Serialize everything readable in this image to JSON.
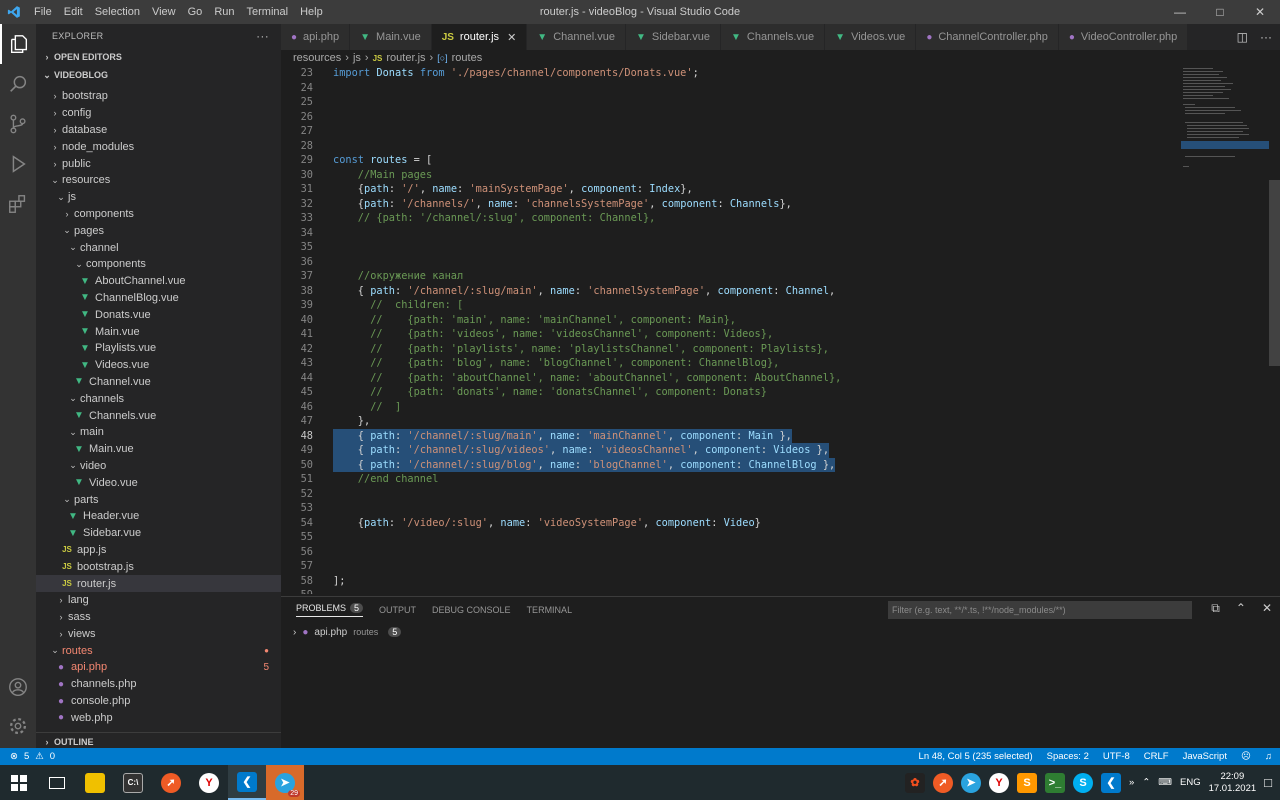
{
  "window": {
    "title": "router.js - videoBlog - Visual Studio Code",
    "menu": [
      "File",
      "Edit",
      "Selection",
      "View",
      "Go",
      "Run",
      "Terminal",
      "Help"
    ]
  },
  "explorer": {
    "header": "EXPLORER",
    "open_editors": "OPEN EDITORS",
    "project": "VIDEOBLOG",
    "outline": "OUTLINE",
    "tree": [
      {
        "label": "bootstrap",
        "depth": 0,
        "type": "folder",
        "open": false
      },
      {
        "label": "config",
        "depth": 0,
        "type": "folder",
        "open": false
      },
      {
        "label": "database",
        "depth": 0,
        "type": "folder",
        "open": false
      },
      {
        "label": "node_modules",
        "depth": 0,
        "type": "folder",
        "open": false
      },
      {
        "label": "public",
        "depth": 0,
        "type": "folder",
        "open": false
      },
      {
        "label": "resources",
        "depth": 0,
        "type": "folder",
        "open": true
      },
      {
        "label": "js",
        "depth": 1,
        "type": "folder",
        "open": true
      },
      {
        "label": "components",
        "depth": 2,
        "type": "folder",
        "open": false
      },
      {
        "label": "pages",
        "depth": 2,
        "type": "folder",
        "open": true
      },
      {
        "label": "channel",
        "depth": 3,
        "type": "folder",
        "open": true
      },
      {
        "label": "components",
        "depth": 4,
        "type": "folder",
        "open": true
      },
      {
        "label": "AboutChannel.vue",
        "depth": 5,
        "type": "vue"
      },
      {
        "label": "ChannelBlog.vue",
        "depth": 5,
        "type": "vue"
      },
      {
        "label": "Donats.vue",
        "depth": 5,
        "type": "vue"
      },
      {
        "label": "Main.vue",
        "depth": 5,
        "type": "vue"
      },
      {
        "label": "Playlists.vue",
        "depth": 5,
        "type": "vue"
      },
      {
        "label": "Videos.vue",
        "depth": 5,
        "type": "vue"
      },
      {
        "label": "Channel.vue",
        "depth": 4,
        "type": "vue"
      },
      {
        "label": "channels",
        "depth": 3,
        "type": "folder",
        "open": true
      },
      {
        "label": "Channels.vue",
        "depth": 4,
        "type": "vue"
      },
      {
        "label": "main",
        "depth": 3,
        "type": "folder",
        "open": true
      },
      {
        "label": "Main.vue",
        "depth": 4,
        "type": "vue"
      },
      {
        "label": "video",
        "depth": 3,
        "type": "folder",
        "open": true
      },
      {
        "label": "Video.vue",
        "depth": 4,
        "type": "vue"
      },
      {
        "label": "parts",
        "depth": 2,
        "type": "folder",
        "open": true
      },
      {
        "label": "Header.vue",
        "depth": 3,
        "type": "vue"
      },
      {
        "label": "Sidebar.vue",
        "depth": 3,
        "type": "vue"
      },
      {
        "label": "app.js",
        "depth": 2,
        "type": "js"
      },
      {
        "label": "bootstrap.js",
        "depth": 2,
        "type": "js"
      },
      {
        "label": "router.js",
        "depth": 2,
        "type": "js",
        "selected": true
      },
      {
        "label": "lang",
        "depth": 1,
        "type": "folder",
        "open": false
      },
      {
        "label": "sass",
        "depth": 1,
        "type": "folder",
        "open": false
      },
      {
        "label": "views",
        "depth": 1,
        "type": "folder",
        "open": false
      },
      {
        "label": "routes",
        "depth": 0,
        "type": "folder",
        "open": true,
        "error": true,
        "dot": "●"
      },
      {
        "label": "api.php",
        "depth": 1,
        "type": "php",
        "error": true,
        "count": "5"
      },
      {
        "label": "channels.php",
        "depth": 1,
        "type": "php"
      },
      {
        "label": "console.php",
        "depth": 1,
        "type": "php"
      },
      {
        "label": "web.php",
        "depth": 1,
        "type": "php"
      }
    ]
  },
  "tabs": [
    {
      "label": "api.php",
      "type": "php"
    },
    {
      "label": "Main.vue",
      "type": "vue"
    },
    {
      "label": "router.js",
      "type": "js",
      "active": true
    },
    {
      "label": "Channel.vue",
      "type": "vue"
    },
    {
      "label": "Sidebar.vue",
      "type": "vue"
    },
    {
      "label": "Channels.vue",
      "type": "vue"
    },
    {
      "label": "Videos.vue",
      "type": "vue"
    },
    {
      "label": "ChannelController.php",
      "type": "php"
    },
    {
      "label": "VideoController.php",
      "type": "php"
    }
  ],
  "breadcrumb": [
    "resources",
    "js",
    "router.js",
    "routes"
  ],
  "code": [
    {
      "n": "23",
      "t": [
        [
          "kw",
          "import "
        ],
        [
          "id",
          "Donats "
        ],
        [
          "kw",
          "from "
        ],
        [
          "str",
          "'./pages/channel/components/Donats.vue'"
        ],
        [
          "pn",
          ";"
        ]
      ]
    },
    {
      "n": "24",
      "t": []
    },
    {
      "n": "25",
      "t": []
    },
    {
      "n": "26",
      "t": []
    },
    {
      "n": "27",
      "t": []
    },
    {
      "n": "28",
      "t": []
    },
    {
      "n": "29",
      "t": [
        [
          "kw",
          "const "
        ],
        [
          "id",
          "routes "
        ],
        [
          "pn",
          "= ["
        ]
      ]
    },
    {
      "n": "30",
      "t": [
        [
          "cm",
          "    //Main pages"
        ]
      ]
    },
    {
      "n": "31",
      "t": [
        [
          "pn",
          "    {"
        ],
        [
          "id",
          "path"
        ],
        [
          "pn",
          ": "
        ],
        [
          "str",
          "'/'"
        ],
        [
          "pn",
          ", "
        ],
        [
          "id",
          "name"
        ],
        [
          "pn",
          ": "
        ],
        [
          "str",
          "'mainSystemPage'"
        ],
        [
          "pn",
          ", "
        ],
        [
          "id",
          "component"
        ],
        [
          "pn",
          ": "
        ],
        [
          "id",
          "Index"
        ],
        [
          "pn",
          "},"
        ]
      ]
    },
    {
      "n": "32",
      "t": [
        [
          "pn",
          "    {"
        ],
        [
          "id",
          "path"
        ],
        [
          "pn",
          ": "
        ],
        [
          "str",
          "'/channels/'"
        ],
        [
          "pn",
          ", "
        ],
        [
          "id",
          "name"
        ],
        [
          "pn",
          ": "
        ],
        [
          "str",
          "'channelsSystemPage'"
        ],
        [
          "pn",
          ", "
        ],
        [
          "id",
          "component"
        ],
        [
          "pn",
          ": "
        ],
        [
          "id",
          "Channels"
        ],
        [
          "pn",
          "},"
        ]
      ]
    },
    {
      "n": "33",
      "t": [
        [
          "cm",
          "    // {path: '/channel/:slug', component: Channel},"
        ]
      ]
    },
    {
      "n": "34",
      "t": []
    },
    {
      "n": "35",
      "t": []
    },
    {
      "n": "36",
      "t": []
    },
    {
      "n": "37",
      "t": [
        [
          "cm",
          "    //окружение канал"
        ]
      ]
    },
    {
      "n": "38",
      "t": [
        [
          "pn",
          "    { "
        ],
        [
          "id",
          "path"
        ],
        [
          "pn",
          ": "
        ],
        [
          "str",
          "'/channel/:slug/main'"
        ],
        [
          "pn",
          ", "
        ],
        [
          "id",
          "name"
        ],
        [
          "pn",
          ": "
        ],
        [
          "str",
          "'channelSystemPage'"
        ],
        [
          "pn",
          ", "
        ],
        [
          "id",
          "component"
        ],
        [
          "pn",
          ": "
        ],
        [
          "id",
          "Channel"
        ],
        [
          "pn",
          ","
        ]
      ]
    },
    {
      "n": "39",
      "t": [
        [
          "cm",
          "      //  children: ["
        ]
      ]
    },
    {
      "n": "40",
      "t": [
        [
          "cm",
          "      //    {path: 'main', name: 'mainChannel', component: Main},"
        ]
      ]
    },
    {
      "n": "41",
      "t": [
        [
          "cm",
          "      //    {path: 'videos', name: 'videosChannel', component: Videos},"
        ]
      ]
    },
    {
      "n": "42",
      "t": [
        [
          "cm",
          "      //    {path: 'playlists', name: 'playlistsChannel', component: Playlists},"
        ]
      ]
    },
    {
      "n": "43",
      "t": [
        [
          "cm",
          "      //    {path: 'blog', name: 'blogChannel', component: ChannelBlog},"
        ]
      ]
    },
    {
      "n": "44",
      "t": [
        [
          "cm",
          "      //    {path: 'aboutChannel', name: 'aboutChannel', component: AboutChannel},"
        ]
      ]
    },
    {
      "n": "45",
      "t": [
        [
          "cm",
          "      //    {path: 'donats', name: 'donatsChannel', component: Donats}"
        ]
      ]
    },
    {
      "n": "46",
      "t": [
        [
          "cm",
          "      //  ]"
        ]
      ]
    },
    {
      "n": "47",
      "t": [
        [
          "pn",
          "    },"
        ]
      ]
    },
    {
      "n": "48",
      "sel": true,
      "cur": true,
      "t": [
        [
          "pn",
          "    { "
        ],
        [
          "id",
          "path"
        ],
        [
          "pn",
          ": "
        ],
        [
          "str",
          "'/channel/:slug/main'"
        ],
        [
          "pn",
          ", "
        ],
        [
          "id",
          "name"
        ],
        [
          "pn",
          ": "
        ],
        [
          "str",
          "'mainChannel'"
        ],
        [
          "pn",
          ", "
        ],
        [
          "id",
          "component"
        ],
        [
          "pn",
          ": "
        ],
        [
          "id",
          "Main "
        ],
        [
          "pn",
          "},"
        ]
      ]
    },
    {
      "n": "49",
      "sel": true,
      "t": [
        [
          "pn",
          "    { "
        ],
        [
          "id",
          "path"
        ],
        [
          "pn",
          ": "
        ],
        [
          "str",
          "'/channel/:slug/videos'"
        ],
        [
          "pn",
          ", "
        ],
        [
          "id",
          "name"
        ],
        [
          "pn",
          ": "
        ],
        [
          "str",
          "'videosChannel'"
        ],
        [
          "pn",
          ", "
        ],
        [
          "id",
          "component"
        ],
        [
          "pn",
          ": "
        ],
        [
          "id",
          "Videos "
        ],
        [
          "pn",
          "},"
        ]
      ]
    },
    {
      "n": "50",
      "sel": true,
      "t": [
        [
          "pn",
          "    { "
        ],
        [
          "id",
          "path"
        ],
        [
          "pn",
          ": "
        ],
        [
          "str",
          "'/channel/:slug/blog'"
        ],
        [
          "pn",
          ", "
        ],
        [
          "id",
          "name"
        ],
        [
          "pn",
          ": "
        ],
        [
          "str",
          "'blogChannel'"
        ],
        [
          "pn",
          ", "
        ],
        [
          "id",
          "component"
        ],
        [
          "pn",
          ": "
        ],
        [
          "id",
          "ChannelBlog "
        ],
        [
          "pn",
          "},"
        ]
      ]
    },
    {
      "n": "51",
      "t": [
        [
          "cm",
          "    //end channel"
        ]
      ]
    },
    {
      "n": "52",
      "t": []
    },
    {
      "n": "53",
      "t": []
    },
    {
      "n": "54",
      "t": [
        [
          "pn",
          "    {"
        ],
        [
          "id",
          "path"
        ],
        [
          "pn",
          ": "
        ],
        [
          "str",
          "'/video/:slug'"
        ],
        [
          "pn",
          ", "
        ],
        [
          "id",
          "name"
        ],
        [
          "pn",
          ": "
        ],
        [
          "str",
          "'videoSystemPage'"
        ],
        [
          "pn",
          ", "
        ],
        [
          "id",
          "component"
        ],
        [
          "pn",
          ": "
        ],
        [
          "id",
          "Video"
        ],
        [
          "pn",
          "}"
        ]
      ]
    },
    {
      "n": "55",
      "t": []
    },
    {
      "n": "56",
      "t": []
    },
    {
      "n": "57",
      "t": []
    },
    {
      "n": "58",
      "t": [
        [
          "pn",
          "];"
        ]
      ]
    },
    {
      "n": "59",
      "t": []
    }
  ],
  "panel": {
    "tabs": [
      {
        "label": "PROBLEMS",
        "badge": "5",
        "active": true
      },
      {
        "label": "OUTPUT"
      },
      {
        "label": "DEBUG CONSOLE"
      },
      {
        "label": "TERMINAL"
      }
    ],
    "filter_placeholder": "Filter (e.g. text, **/*.ts, !**/node_modules/**)",
    "problem_file": "api.php",
    "problem_folder": "routes",
    "problem_count": "5"
  },
  "status": {
    "errors": "5",
    "warnings": "0",
    "position": "Ln 48, Col 5 (235 selected)",
    "spaces": "Spaces: 2",
    "encoding": "UTF-8",
    "eol": "CRLF",
    "language": "JavaScript"
  },
  "taskbar": {
    "lang": "ENG",
    "time": "22:09",
    "date": "17.01.2021",
    "telegram_badge": "29"
  }
}
